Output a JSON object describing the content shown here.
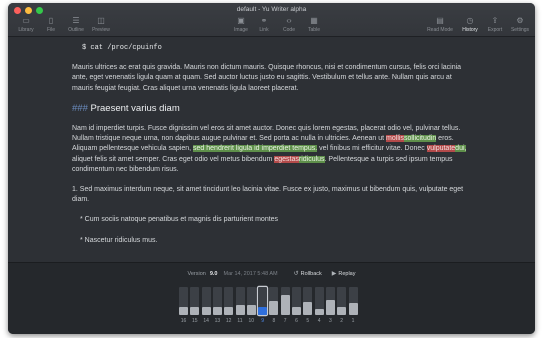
{
  "window": {
    "title": "default - Yu Writer alpha"
  },
  "toolbar": {
    "left": [
      {
        "label": "Library",
        "icon": "folder-icon",
        "glyph": "▭"
      },
      {
        "label": "File",
        "icon": "file-icon",
        "glyph": "▯"
      },
      {
        "label": "Outline",
        "icon": "outline-icon",
        "glyph": "☰"
      },
      {
        "label": "Preview",
        "icon": "preview-icon",
        "glyph": "◫"
      }
    ],
    "center": [
      {
        "label": "Image",
        "icon": "image-icon",
        "glyph": "▣"
      },
      {
        "label": "Link",
        "icon": "link-icon",
        "glyph": "⚭"
      },
      {
        "label": "Code",
        "icon": "code-icon",
        "glyph": "‹›"
      },
      {
        "label": "Table",
        "icon": "table-icon",
        "glyph": "▦"
      }
    ],
    "right": [
      {
        "label": "Read Mode",
        "icon": "read-mode-icon",
        "glyph": "▤"
      },
      {
        "label": "History",
        "icon": "history-icon",
        "glyph": "◷",
        "active": true
      },
      {
        "label": "Export",
        "icon": "export-icon",
        "glyph": "⇪"
      },
      {
        "label": "Settings",
        "icon": "gear-icon",
        "glyph": "⚙"
      }
    ]
  },
  "editor": {
    "code_line": "$ cat /proc/cpuinfo",
    "para1": "Mauris ultrices ac erat quis gravida. Mauris non dictum mauris. Quisque rhoncus, nisi et condimentum cursus, felis orci lacinia ante, eget venenatis ligula quam at quam. Sed auctor luctus justo eu sagittis. Vestibulum et tellus ante. Nullam quis arcu at mauris feugiat feugiat. Cras aliquet urna venenatis ligula laoreet placerat.",
    "heading_marker": "###",
    "heading_text": "Praesent varius diam",
    "para2": [
      {
        "t": "Nam id imperdiet turpis. Fusce dignissim vel eros sit amet auctor. Donec quis lorem egestas, placerat odio vel, pulvinar tellus. Nullam tristique neque urna, non dapibus augue pulvinar et. Sed porta ac nulla in ultricies. Aenean ut "
      },
      {
        "t": "mollis",
        "hl": "red"
      },
      {
        "t": "sollicitudin",
        "hl": "green"
      },
      {
        "t": " eros. Aliquam pellentesque vehicula sapien, "
      },
      {
        "t": "sed hendrerit ligula id imperdiet tempus.",
        "hl": "green"
      },
      {
        "t": " vel finibus mi efficitur vitae. Donec "
      },
      {
        "t": "vulputate",
        "hl": "red"
      },
      {
        "t": "dui,",
        "hl": "green"
      },
      {
        "t": " aliquet felis sit amet semper. Cras eget odio vel metus bibendum "
      },
      {
        "t": "egestas",
        "hl": "red"
      },
      {
        "t": "ridiculus",
        "hl": "green"
      },
      {
        "t": ". Pellentesque a turpis sed ipsum tempus condimentum nec bibendum risus."
      }
    ],
    "list_item": "1. Sed maximus interdum neque, sit amet tincidunt leo lacinia vitae. Fusce ex justo, maximus ut bibendum quis, vulputate eget diam.",
    "bullet1": "* Cum sociis natoque penatibus et magnis dis parturient montes",
    "bullet2": "* Nascetur ridiculus mus."
  },
  "history": {
    "version_label": "Version",
    "version_number": "9.0",
    "date": "Mar 14, 2017 5:48 AM",
    "rollback_label": "Rollback",
    "replay_label": "Replay",
    "selected_version": "9",
    "versions": [
      {
        "n": "16",
        "level": 0.28
      },
      {
        "n": "15",
        "level": 0.28
      },
      {
        "n": "14",
        "level": 0.28
      },
      {
        "n": "13",
        "level": 0.28
      },
      {
        "n": "12",
        "level": 0.28
      },
      {
        "n": "11",
        "level": 0.34
      },
      {
        "n": "10",
        "level": 0.34
      },
      {
        "n": "9",
        "level": 0.3
      },
      {
        "n": "8",
        "level": 0.5
      },
      {
        "n": "7",
        "level": 0.7
      },
      {
        "n": "6",
        "level": 0.3
      },
      {
        "n": "5",
        "level": 0.45
      },
      {
        "n": "4",
        "level": 0.22
      },
      {
        "n": "3",
        "level": 0.55
      },
      {
        "n": "2",
        "level": 0.3
      },
      {
        "n": "1",
        "level": 0.42
      }
    ]
  }
}
